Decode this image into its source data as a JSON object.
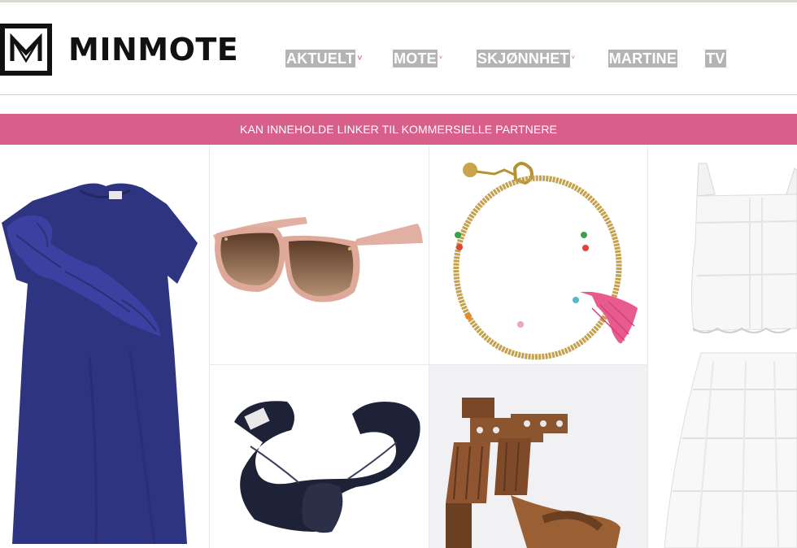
{
  "brand": {
    "name": "MINMOTE",
    "logo_icon": "logo-mark-icon"
  },
  "nav": {
    "items": [
      {
        "label": "AKTUELT",
        "has_dropdown": true
      },
      {
        "label": "MOTE",
        "has_dropdown": true
      },
      {
        "label": "SKJØNNHET",
        "has_dropdown": true
      },
      {
        "label": "MARTINE",
        "has_dropdown": false
      },
      {
        "label": "TV",
        "has_dropdown": false
      }
    ],
    "dropdown_icon": "chevron-down-icon"
  },
  "banner": {
    "text": "KAN INNEHOLDE LINKER TIL KOMMERSIELLE PARTNERE",
    "color": "#d85f89"
  },
  "products": [
    {
      "id": "dress",
      "icon": "navy-ruffle-dress-icon"
    },
    {
      "id": "sunglasses",
      "icon": "pink-sunglasses-icon"
    },
    {
      "id": "bracelet",
      "icon": "gold-bead-tassel-bracelet-icon"
    },
    {
      "id": "white-set",
      "icon": "white-lace-top-skirt-icon"
    },
    {
      "id": "headband",
      "icon": "navy-knot-headband-icon"
    },
    {
      "id": "sandals",
      "icon": "brown-tassel-heeled-sandals-icon"
    }
  ],
  "colors": {
    "accent": "#d85f89",
    "nav_highlight": "#b4b4b4",
    "navy": "#2e3480"
  }
}
